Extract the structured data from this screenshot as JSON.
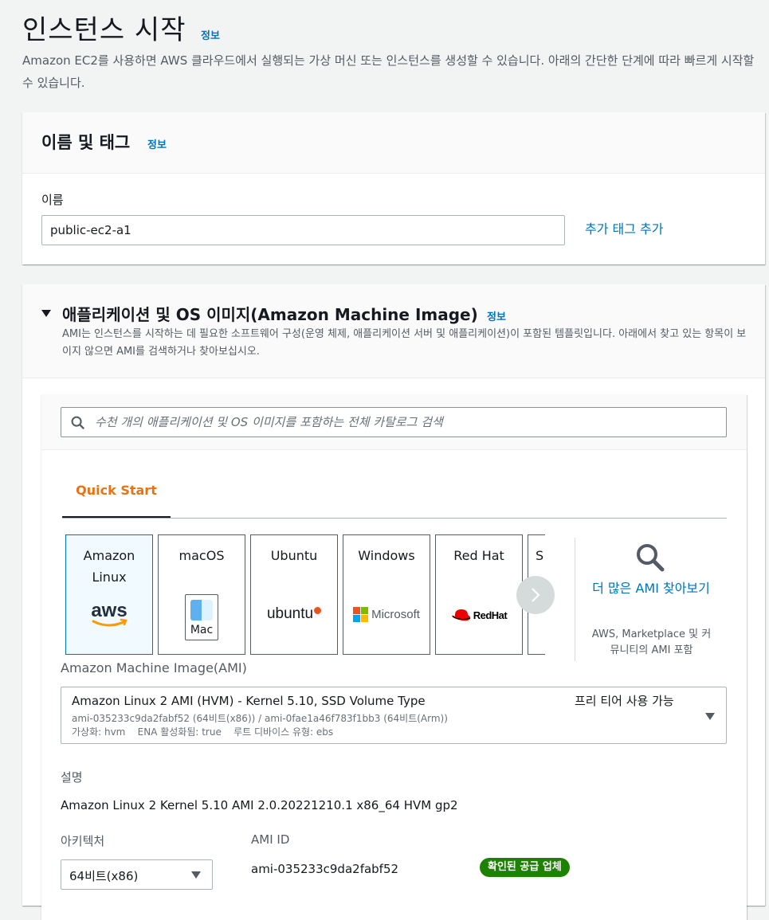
{
  "page": {
    "title": "인스턴스 시작",
    "info_link": "정보",
    "description": "Amazon EC2를 사용하면 AWS 클라우드에서 실행되는 가상 머신 또는 인스턴스를 생성할 수 있습니다. 아래의 간단한 단계에 따라 빠르게 시작할 수 있습니다."
  },
  "name_tags": {
    "title": "이름 및 태그",
    "info_link": "정보",
    "name_label": "이름",
    "name_value": "public-ec2-a1",
    "add_tag_link": "추가 태그 추가"
  },
  "ami": {
    "title": "애플리케이션 및 OS 이미지(Amazon Machine Image)",
    "info_link": "정보",
    "description": "AMI는 인스턴스를 시작하는 데 필요한 소프트웨어 구성(운영 체제, 애플리케이션 서버 및 애플리케이션)이 포함된 템플릿입니다. 아래에서 찾고 있는 항목이 보이지 않으면 AMI를 검색하거나 찾아보십시오.",
    "search_placeholder": "수천 개의 애플리케이션 및 OS 이미지를 포함하는 전체 카탈로그 검색",
    "tab_label": "Quick Start",
    "os_tiles": [
      {
        "name": "Amazon Linux",
        "logo": "aws-logo",
        "logo_text": "aws",
        "selected": true
      },
      {
        "name": "macOS",
        "logo": "mac-finder-logo",
        "logo_text": "Mac",
        "selected": false
      },
      {
        "name": "Ubuntu",
        "logo": "ubuntu-logo",
        "logo_text": "ubuntu",
        "selected": false
      },
      {
        "name": "Windows",
        "logo": "microsoft-logo",
        "logo_text": "Microsoft",
        "selected": false
      },
      {
        "name": "Red Hat",
        "logo": "redhat-logo",
        "logo_text": "Red Hat",
        "selected": false
      },
      {
        "name": "S",
        "logo": "",
        "logo_text": "",
        "selected": false
      }
    ],
    "browse_more": {
      "link": "더 많은 AMI 찾아보기",
      "sub": "AWS, Marketplace 및 커뮤니티의 AMI 포함"
    },
    "ami_label": "Amazon Machine Image(AMI)",
    "selected_ami": {
      "name": "Amazon Linux 2 AMI (HVM) - Kernel 5.10, SSD Volume Type",
      "ids": "ami-035233c9da2fabf52 (64비트(x86)) / ami-0fae1a46f783f1bb3 (64비트(Arm))",
      "attrs": "가상화: hvm    ENA 활성화됨: true    루트 디바이스 유형: ebs",
      "free_tier": "프리 티어 사용 가능"
    },
    "desc_label": "설명",
    "desc_value": "Amazon Linux 2 Kernel 5.10 AMI 2.0.20221210.1 x86_64 HVM gp2",
    "arch_label": "아키텍처",
    "arch_value": "64비트(x86)",
    "ami_id_label": "AMI ID",
    "ami_id_value": "ami-035233c9da2fabf52",
    "verified_badge": "확인된 공급 업체"
  },
  "colors": {
    "link": "#0073bb",
    "accent_orange": "#ec7211",
    "badge_green": "#1d8102"
  }
}
